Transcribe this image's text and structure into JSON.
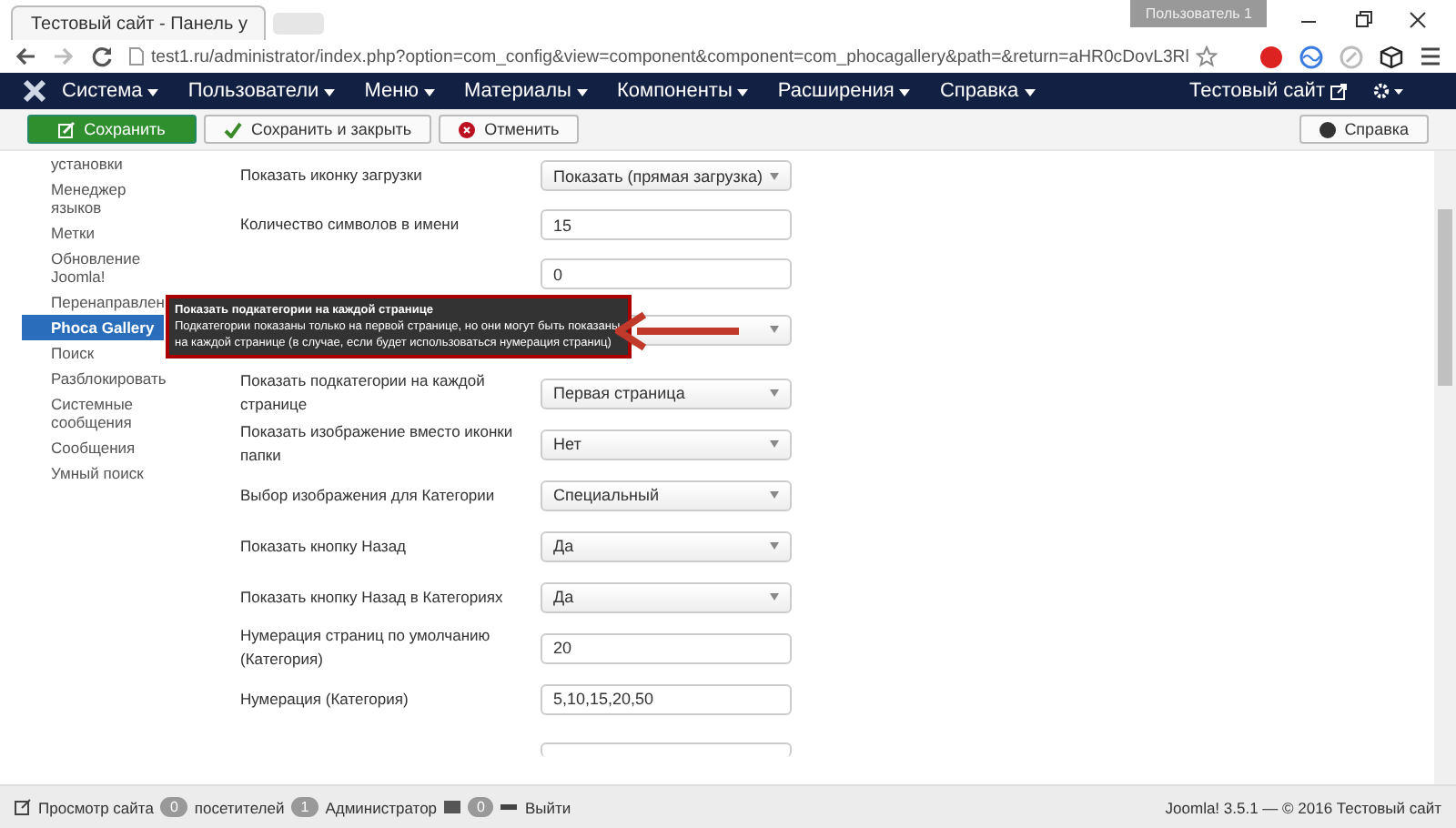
{
  "browser": {
    "tab_title": "Тестовый сайт - Панель у",
    "user_badge": "Пользователь 1",
    "url": "test1.ru/administrator/index.php?option=com_config&view=component&component=com_phocagallery&path=&return=aHR0cDovL3Rl"
  },
  "navbar": {
    "items": [
      {
        "label": "Система"
      },
      {
        "label": "Пользователи"
      },
      {
        "label": "Меню"
      },
      {
        "label": "Материалы"
      },
      {
        "label": "Компоненты"
      },
      {
        "label": "Расширения"
      },
      {
        "label": "Справка"
      }
    ],
    "site_link": "Тестовый сайт"
  },
  "toolbar": {
    "buttons": [
      {
        "label": "Сохранить",
        "kind": "save"
      },
      {
        "label": "Сохранить и закрыть",
        "kind": "check"
      },
      {
        "label": "Отменить",
        "kind": "cancel"
      }
    ],
    "help": "Справка"
  },
  "sidebar": {
    "items": [
      {
        "label": "установки",
        "selected": false
      },
      {
        "label": "Менеджер языков",
        "selected": false
      },
      {
        "label": "Метки",
        "selected": false
      },
      {
        "label": "Обновление Joomla!",
        "selected": false
      },
      {
        "label": "Перенаправлен",
        "selected": false
      },
      {
        "label": "Phoca Gallery",
        "selected": true
      },
      {
        "label": "Поиск",
        "selected": false
      },
      {
        "label": "Разблокировать",
        "selected": false
      },
      {
        "label": "Системные сообщения",
        "selected": false
      },
      {
        "label": "Сообщения",
        "selected": false
      },
      {
        "label": "Умный поиск",
        "selected": false
      }
    ]
  },
  "fields": [
    {
      "label": "Показать иконку загрузки",
      "kind": "select",
      "value": "Показать (прямая загрузка)"
    },
    {
      "label": "Количество символов в имени",
      "kind": "text",
      "value": "15"
    },
    {
      "kind": "text",
      "value": "0"
    },
    {
      "kind": "select"
    },
    {
      "label": "Показать подкатегории на каждой странице",
      "kind": "select",
      "value": "Первая страница"
    },
    {
      "label": "Показать изображение вместо иконки папки",
      "kind": "select",
      "value": "Нет"
    },
    {
      "label": "Выбор изображения для Категории",
      "kind": "select",
      "value": "Специальный"
    },
    {
      "label": "Показать кнопку Назад",
      "kind": "select",
      "value": "Да"
    },
    {
      "label": "Показать кнопку Назад в Категориях",
      "kind": "select",
      "value": "Да"
    },
    {
      "label": "Нумерация страниц по умолчанию (Категория)",
      "kind": "text",
      "value": "20"
    },
    {
      "label": "Нумерация (Категория)",
      "kind": "text",
      "value": "5,10,15,20,50"
    }
  ],
  "tooltip": {
    "title": "Показать подкатегории на каждой странице",
    "text": "Подкатегории показаны только на первой странице, но они могут быть показаны на каждой странице (в случае, если будет использоваться нумерация страниц)"
  },
  "status_bar": {
    "view_site": "Просмотр сайта",
    "visitors_count": "0",
    "visitors_label": "посетителей",
    "admins_count": "1",
    "admins_label": "Администратор",
    "messages_count": "0",
    "logout": "Выйти",
    "copyright": "Joomla! 3.5.1 — © 2016 Тестовый сайт"
  }
}
